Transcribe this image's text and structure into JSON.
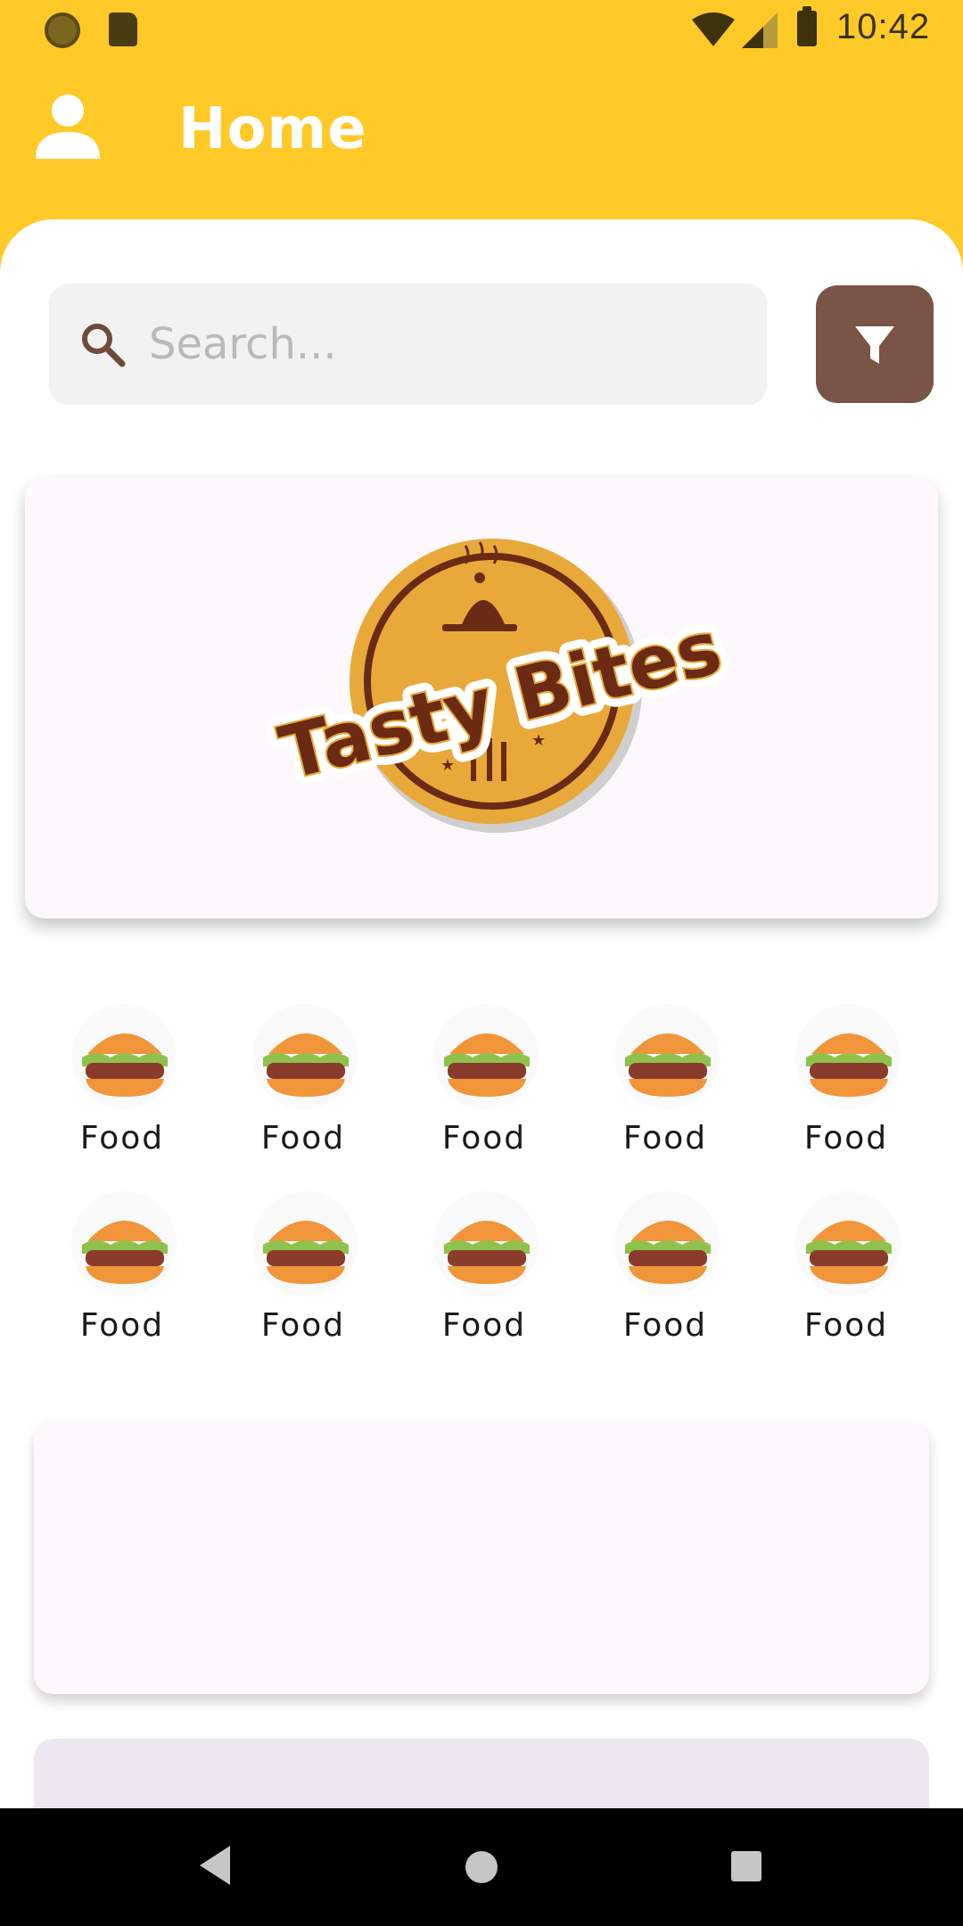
{
  "status_bar": {
    "time": "10:42",
    "icons": [
      "sun-icon",
      "sd-card-icon",
      "wifi-icon",
      "cell-signal-icon",
      "battery-icon"
    ]
  },
  "app_bar": {
    "title": "Home",
    "profile_icon": "person-icon"
  },
  "search": {
    "placeholder": "Search...",
    "value": "",
    "icon": "search-icon"
  },
  "filter": {
    "icon": "filter-icon"
  },
  "banner": {
    "logo_text": "Tasty Bites"
  },
  "categories": [
    {
      "label": "Food",
      "icon": "burger-icon"
    },
    {
      "label": "Food",
      "icon": "burger-icon"
    },
    {
      "label": "Food",
      "icon": "burger-icon"
    },
    {
      "label": "Food",
      "icon": "burger-icon"
    },
    {
      "label": "Food",
      "icon": "burger-icon"
    },
    {
      "label": "Food",
      "icon": "burger-icon"
    },
    {
      "label": "Food",
      "icon": "burger-icon"
    },
    {
      "label": "Food",
      "icon": "burger-icon"
    },
    {
      "label": "Food",
      "icon": "burger-icon"
    },
    {
      "label": "Food",
      "icon": "burger-icon"
    }
  ],
  "nav_bar": {
    "buttons": [
      "back-icon",
      "home-icon",
      "recents-icon"
    ]
  },
  "colors": {
    "app_bar": "#FFC928",
    "filter_button": "#7A5545",
    "search_bg": "#F2F2F2",
    "card_bg": "#FDF8FB",
    "logo_gold": "#E8A93A",
    "logo_brown": "#6B2A14"
  }
}
